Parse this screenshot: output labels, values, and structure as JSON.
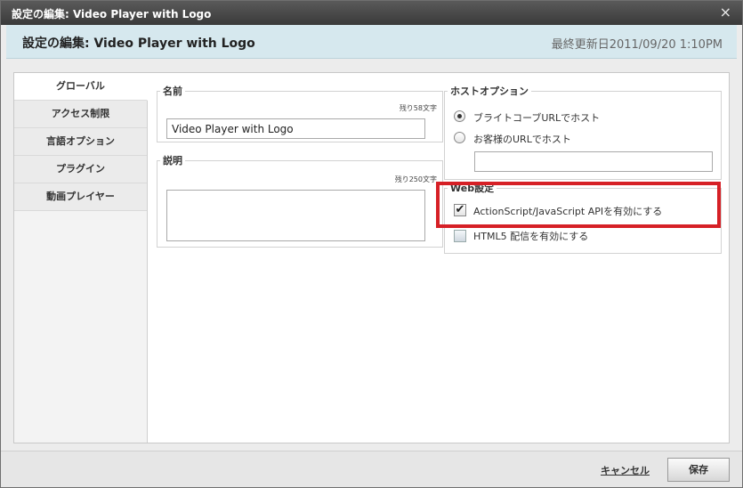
{
  "window": {
    "title": "設定の編集: Video Player with Logo",
    "close_icon": "×"
  },
  "header": {
    "title": "設定の編集: Video Player with Logo",
    "last_updated": "最終更新日2011/09/20 1:10PM"
  },
  "sidebar": {
    "items": [
      {
        "label": "グローバル"
      },
      {
        "label": "アクセス制限"
      },
      {
        "label": "言語オプション"
      },
      {
        "label": "プラグイン"
      },
      {
        "label": "動画プレイヤー"
      }
    ]
  },
  "name_section": {
    "legend": "名前",
    "counter": "残り58文字",
    "value": "Video Player with Logo"
  },
  "desc_section": {
    "legend": "説明",
    "counter": "残り250文字",
    "value": ""
  },
  "host_section": {
    "legend": "ホストオプション",
    "option1": "ブライトコーブURLでホスト",
    "option2": "お客様のURLでホスト",
    "url_value": ""
  },
  "web_section": {
    "legend": "Web設定",
    "option1": "ActionScript/JavaScript APIを有効にする",
    "option2": "HTML5 配信を有効にする",
    "check_glyph": "✔"
  },
  "footer": {
    "cancel_label": "キャンセル",
    "save_label": "保存"
  },
  "colors": {
    "highlight": "#d62026",
    "header_bg": "#d6e8ee"
  }
}
